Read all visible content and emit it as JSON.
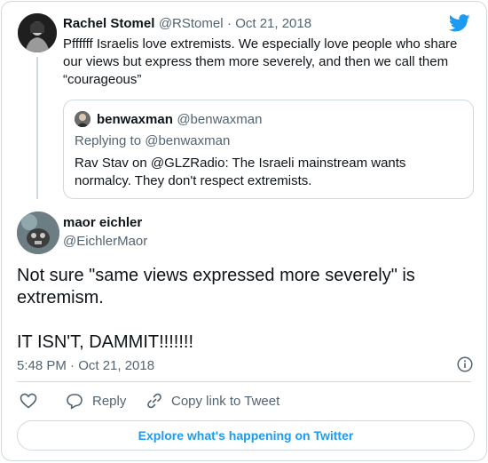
{
  "quoted_parent": {
    "author_name": "Rachel Stomel",
    "author_handle": "@RStomel",
    "date": "· Oct 21, 2018",
    "text": "Pffffff Israelis love extremists. We especially love people who share our views but express them more severely, and then we call them “courageous”"
  },
  "inner_quote": {
    "author_name": "benwaxman",
    "author_handle": "@benwaxman",
    "replying_to": "Replying to @benwaxman",
    "text": "Rav Stav on @GLZRadio:  The Israeli mainstream wants normalcy. They don't respect extremists."
  },
  "tweet": {
    "author_name": "maor eichler",
    "author_handle": "@EichlerMaor",
    "text_line1": "Not sure \"same views expressed more severely\" is extremism.",
    "text_line2": "IT ISN'T, DAMMIT!!!!!!!",
    "timestamp": "5:48 PM · Oct 21, 2018"
  },
  "actions": {
    "reply_label": "Reply",
    "copy_label": "Copy link to Tweet",
    "explore_label": "Explore what's happening on Twitter"
  },
  "icons": {
    "brand": "twitter-bird-icon",
    "like": "heart-icon",
    "reply": "reply-bubble-icon",
    "copy": "link-icon",
    "info": "info-icon"
  },
  "colors": {
    "brand_blue": "#1d9bf0",
    "muted_text": "#536471",
    "border": "#cfd9de"
  }
}
